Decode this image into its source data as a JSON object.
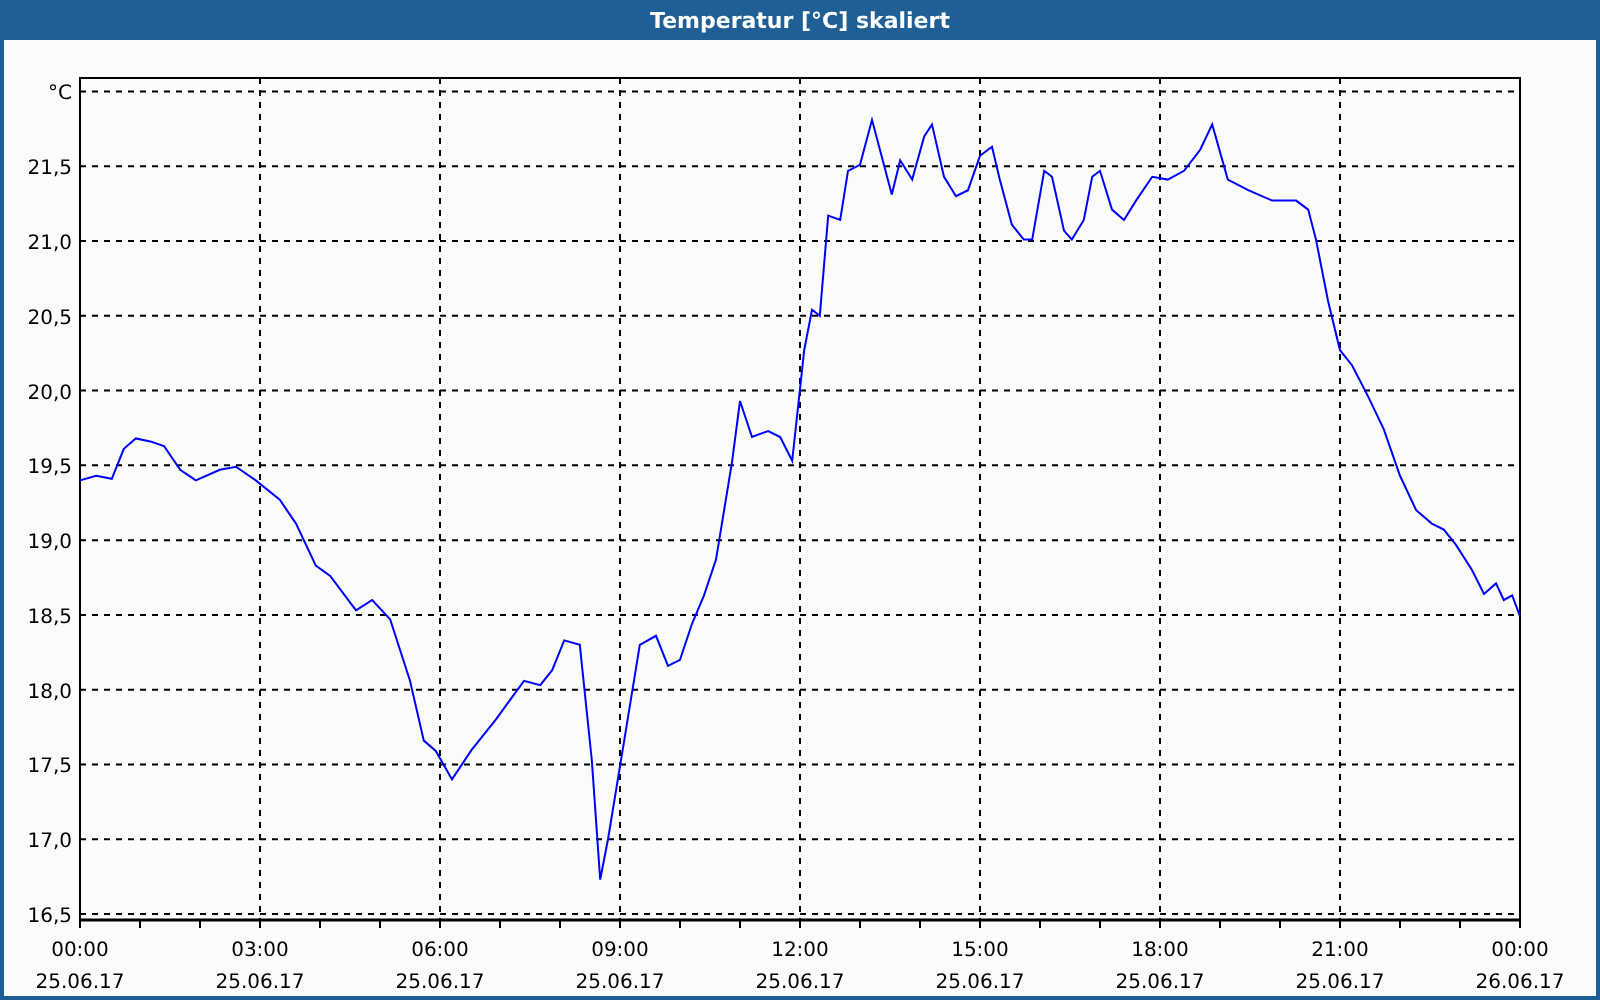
{
  "window": {
    "title": "Temperatur [°C] skaliert"
  },
  "chart": {
    "chart_data": {
      "type": "line",
      "xlim": [
        0,
        24
      ],
      "ylim": [
        16.46,
        22.09
      ],
      "grid": true,
      "xticks": [
        {
          "value": 0,
          "label": "00:00"
        },
        {
          "value": 3,
          "label": "03:00"
        },
        {
          "value": 6,
          "label": "06:00"
        },
        {
          "value": 9,
          "label": "09:00"
        },
        {
          "value": 12,
          "label": "12:00"
        },
        {
          "value": 15,
          "label": "15:00"
        },
        {
          "value": 18,
          "label": "18:00"
        },
        {
          "value": 21,
          "label": "21:00"
        },
        {
          "value": 24,
          "label": "00:00"
        }
      ],
      "annotations": [
        "25.06.17",
        "25.06.17",
        "25.06.17",
        "25.06.17",
        "25.06.17",
        "25.06.17",
        "25.06.17",
        "25.06.17",
        "26.06.17"
      ],
      "yticks": [
        {
          "value": 16.5,
          "label": "16,5"
        },
        {
          "value": 17,
          "label": "17,0"
        },
        {
          "value": 17.5,
          "label": "17,5"
        },
        {
          "value": 18,
          "label": "18,0"
        },
        {
          "value": 18.5,
          "label": "18,5"
        },
        {
          "value": 19,
          "label": "19,0"
        },
        {
          "value": 19.5,
          "label": "19,5"
        },
        {
          "value": 20,
          "label": "20,0"
        },
        {
          "value": 20.5,
          "label": "20,5"
        },
        {
          "value": 21,
          "label": "21,0"
        },
        {
          "value": 21.5,
          "label": "21,5"
        },
        {
          "value": 22,
          "label": "°C"
        }
      ],
      "x": [
        0,
        0.27,
        0.53,
        0.73,
        0.93,
        1.17,
        1.4,
        1.67,
        1.93,
        2.33,
        2.6,
        2.93,
        3.33,
        3.6,
        3.93,
        4.17,
        4.6,
        4.87,
        5.17,
        5.5,
        5.73,
        5.93,
        6.2,
        6.53,
        6.93,
        7.4,
        7.67,
        7.87,
        8.07,
        8.33,
        8.53,
        8.67,
        8.8,
        9.07,
        9.33,
        9.6,
        9.8,
        10,
        10.2,
        10.4,
        10.6,
        10.87,
        11,
        11.2,
        11.47,
        11.67,
        11.87,
        12.07,
        12.2,
        12.33,
        12.47,
        12.67,
        12.8,
        13,
        13.2,
        13.53,
        13.67,
        13.87,
        14.07,
        14.2,
        14.4,
        14.6,
        14.8,
        15,
        15.2,
        15.33,
        15.53,
        15.73,
        15.87,
        16.07,
        16.2,
        16.4,
        16.53,
        16.73,
        16.87,
        17,
        17.2,
        17.4,
        17.6,
        17.87,
        18.13,
        18.4,
        18.67,
        18.87,
        19.13,
        19.47,
        19.87,
        20.27,
        20.47,
        20.6,
        20.8,
        21,
        21.2,
        21.47,
        21.73,
        22,
        22.27,
        22.53,
        22.73,
        22.93,
        23.2,
        23.4,
        23.6,
        23.73,
        23.87,
        24
      ],
      "series": [
        {
          "color": "#0000ff",
          "values": [
            19.4,
            19.43,
            19.41,
            19.61,
            19.68,
            19.66,
            19.63,
            19.47,
            19.4,
            19.47,
            19.49,
            19.4,
            19.27,
            19.11,
            18.83,
            18.76,
            18.53,
            18.6,
            18.47,
            18.06,
            17.66,
            17.59,
            17.4,
            17.6,
            17.8,
            18.06,
            18.03,
            18.13,
            18.33,
            18.3,
            17.53,
            16.73,
            17.0,
            17.66,
            18.3,
            18.36,
            18.16,
            18.2,
            18.44,
            18.63,
            18.87,
            19.53,
            19.93,
            19.69,
            19.73,
            19.69,
            19.53,
            20.27,
            20.54,
            20.5,
            21.17,
            21.14,
            21.47,
            21.51,
            21.81,
            21.31,
            21.54,
            21.41,
            21.7,
            21.78,
            21.43,
            21.3,
            21.34,
            21.57,
            21.63,
            21.41,
            21.11,
            21.01,
            21.01,
            21.47,
            21.43,
            21.07,
            21.01,
            21.14,
            21.43,
            21.47,
            21.21,
            21.14,
            21.27,
            21.43,
            21.41,
            21.47,
            21.61,
            21.78,
            21.41,
            21.34,
            21.27,
            21.27,
            21.21,
            21.01,
            20.6,
            20.27,
            20.17,
            19.96,
            19.74,
            19.43,
            19.2,
            19.11,
            19.07,
            18.97,
            18.8,
            18.64,
            18.71,
            18.6,
            18.63,
            18.49
          ]
        }
      ]
    }
  }
}
